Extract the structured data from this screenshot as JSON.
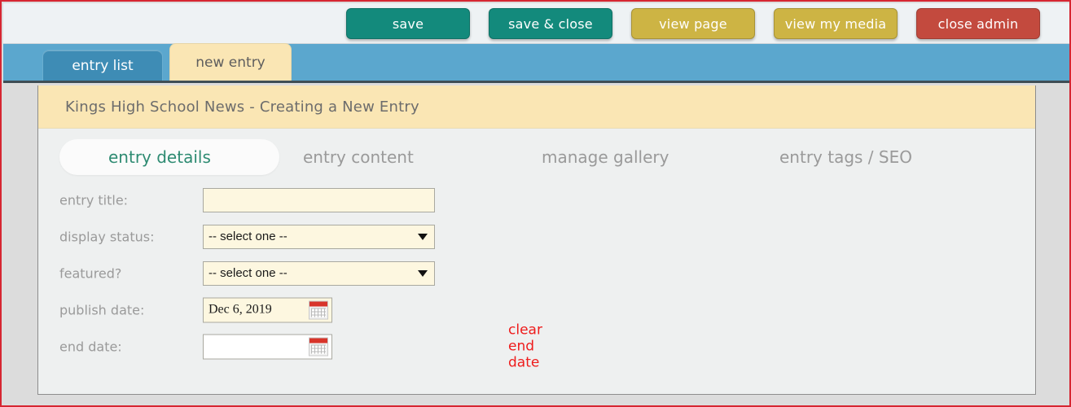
{
  "toolbar": {
    "buttons": [
      {
        "label": "save",
        "style": "teal"
      },
      {
        "label": "save & close",
        "style": "teal"
      },
      {
        "label": "view page",
        "style": "gold"
      },
      {
        "label": "view my media",
        "style": "gold"
      },
      {
        "label": "close admin",
        "style": "red"
      }
    ]
  },
  "tabs": [
    {
      "label": "entry list",
      "active": false
    },
    {
      "label": "new entry",
      "active": true
    }
  ],
  "card": {
    "banner_title": "Kings High School News - Creating a New Entry",
    "subtabs": [
      {
        "label": "entry details",
        "active": true
      },
      {
        "label": "entry content",
        "active": false
      },
      {
        "label": "manage gallery",
        "active": false
      },
      {
        "label": "entry tags / SEO",
        "active": false
      }
    ],
    "form": {
      "entry_title": {
        "label": "entry title:",
        "value": "",
        "placeholder": ""
      },
      "display_status": {
        "label": "display status:",
        "value": "-- select one --"
      },
      "featured": {
        "label": "featured?",
        "value": "-- select one --"
      },
      "publish_date": {
        "label": "publish date:",
        "value": "Dec 6, 2019"
      },
      "end_date": {
        "label": "end date:",
        "value": "",
        "clear_link": "clear end date"
      }
    }
  },
  "colors": {
    "teal": "#138a7c",
    "gold": "#cdb444",
    "red": "#c34a3e",
    "tabbar_blue": "#5ba7ce",
    "active_tab_cream": "#fae6b4",
    "accent_green": "#2e8b72",
    "link_red": "#ee1c1c",
    "page_border": "#d62631"
  }
}
